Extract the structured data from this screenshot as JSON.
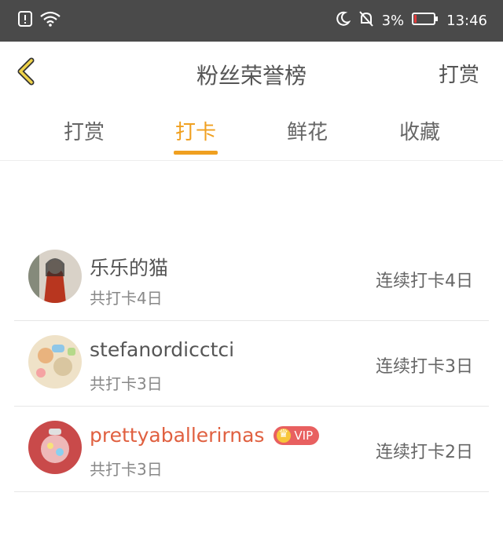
{
  "status": {
    "battery_percent": "3%",
    "time": "13:46"
  },
  "header": {
    "title": "粉丝荣誉榜",
    "action": "打赏"
  },
  "tabs": [
    {
      "label": "打赏"
    },
    {
      "label": "打卡"
    },
    {
      "label": "鲜花"
    },
    {
      "label": "收藏"
    }
  ],
  "fans": [
    {
      "name": "乐乐的猫",
      "total": "共打卡4日",
      "streak": "连续打卡4日"
    },
    {
      "name": "stefanordicctci",
      "total": "共打卡3日",
      "streak": "连续打卡3日"
    },
    {
      "name": "prettyaballerirnas",
      "total": "共打卡3日",
      "streak": "连续打卡2日",
      "vip_label": "VIP"
    }
  ],
  "colors": {
    "accent": "#f0a020",
    "vip": "#e06040",
    "status_bar": "#4a4a4a"
  }
}
